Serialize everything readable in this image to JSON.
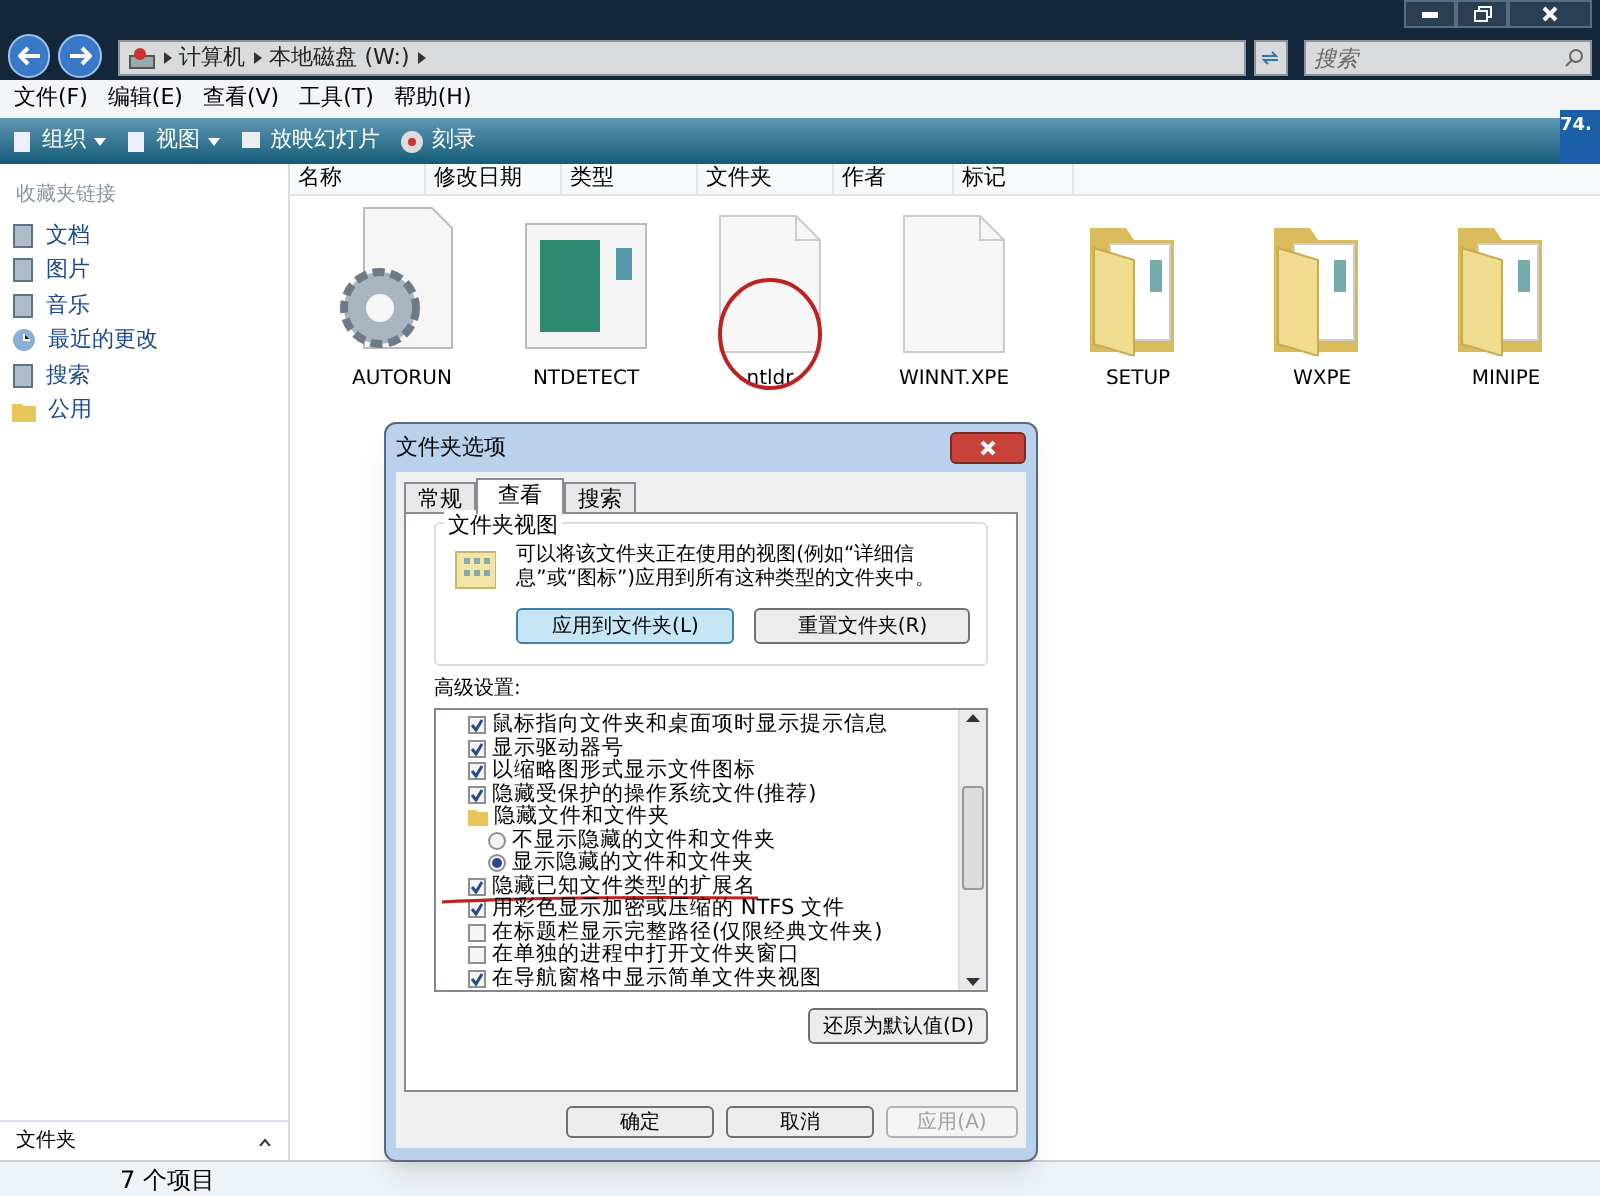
{
  "address_bar": {
    "crumbs": [
      "计算机",
      "本地磁盘 (W:)"
    ]
  },
  "search": {
    "placeholder": "搜索"
  },
  "menu_bar": [
    "文件(F)",
    "编辑(E)",
    "查看(V)",
    "工具(T)",
    "帮助(H)"
  ],
  "toolbar": [
    {
      "label": "组织",
      "kind": "dropdown"
    },
    {
      "label": "视图",
      "kind": "dropdown"
    },
    {
      "label": "放映幻灯片",
      "kind": "slideshow"
    },
    {
      "label": "刻录",
      "kind": "burn"
    }
  ],
  "toolbar_badge": "74.",
  "sidebar": {
    "heading": "收藏夹链接",
    "items": [
      {
        "label": "文档",
        "kind": "doc"
      },
      {
        "label": "图片",
        "kind": "doc"
      },
      {
        "label": "音乐",
        "kind": "doc"
      },
      {
        "label": "最近的更改",
        "kind": "recent"
      },
      {
        "label": "搜索",
        "kind": "doc"
      },
      {
        "label": "公用",
        "kind": "folder"
      }
    ],
    "footer": "文件夹"
  },
  "columns": [
    "名称",
    "修改日期",
    "类型",
    "文件夹",
    "作者",
    "标记"
  ],
  "files": [
    {
      "name": "AUTORUN",
      "kind": "settings",
      "circled": false
    },
    {
      "name": "NTDETECT",
      "kind": "app",
      "circled": false
    },
    {
      "name": "ntldr",
      "kind": "file",
      "circled": true
    },
    {
      "name": "WINNT.XPE",
      "kind": "file",
      "circled": false
    },
    {
      "name": "SETUP",
      "kind": "folder",
      "circled": false
    },
    {
      "name": "WXPE",
      "kind": "folder",
      "circled": false
    },
    {
      "name": "MINIPE",
      "kind": "folder",
      "circled": false
    }
  ],
  "status_bar": {
    "count": "7 个项目"
  },
  "dialog": {
    "title": "文件夹选项",
    "tabs": [
      {
        "label": "常规",
        "selected": false
      },
      {
        "label": "查看",
        "selected": true
      },
      {
        "label": "搜索",
        "selected": false
      }
    ],
    "folder_views": {
      "heading": "文件夹视图",
      "text": "可以将该文件夹正在使用的视图(例如“详细信息”或“图标”)应用到所有这种类型的文件夹中。",
      "buttons": [
        {
          "label": "应用到文件夹(L)",
          "focused": true
        },
        {
          "label": "重置文件夹(R)",
          "focused": false
        }
      ]
    },
    "advanced_label": "高级设置:",
    "settings": [
      {
        "kind": "checkbox",
        "label": "鼠标指向文件夹和桌面项时显示提示信息",
        "checked": true,
        "underlined": false
      },
      {
        "kind": "checkbox",
        "label": "显示驱动器号",
        "checked": true,
        "underlined": false
      },
      {
        "kind": "checkbox",
        "label": "以缩略图形式显示文件图标",
        "checked": true,
        "underlined": false
      },
      {
        "kind": "checkbox",
        "label": "隐藏受保护的操作系统文件(推荐)",
        "checked": true,
        "underlined": false
      },
      {
        "kind": "folder",
        "label": "隐藏文件和文件夹"
      },
      {
        "kind": "radio",
        "label": "不显示隐藏的文件和文件夹",
        "checked": false
      },
      {
        "kind": "radio",
        "label": "显示隐藏的文件和文件夹",
        "checked": true
      },
      {
        "kind": "checkbox",
        "label": "隐藏已知文件类型的扩展名",
        "checked": true,
        "underlined": true
      },
      {
        "kind": "checkbox",
        "label": "用彩色显示加密或压缩的 NTFS 文件",
        "checked": true,
        "underlined": false
      },
      {
        "kind": "checkbox",
        "label": "在标题栏显示完整路径(仅限经典文件夹)",
        "checked": false,
        "underlined": false
      },
      {
        "kind": "checkbox",
        "label": "在单独的进程中打开文件夹窗口",
        "checked": false,
        "underlined": false
      },
      {
        "kind": "checkbox",
        "label": "在导航窗格中显示简单文件夹视图",
        "checked": true,
        "underlined": false
      }
    ],
    "restore_button": "还原为默认值(D)",
    "footer_buttons": [
      {
        "label": "确定",
        "disabled": false
      },
      {
        "label": "取消",
        "disabled": false
      },
      {
        "label": "应用(A)",
        "disabled": true
      }
    ]
  }
}
